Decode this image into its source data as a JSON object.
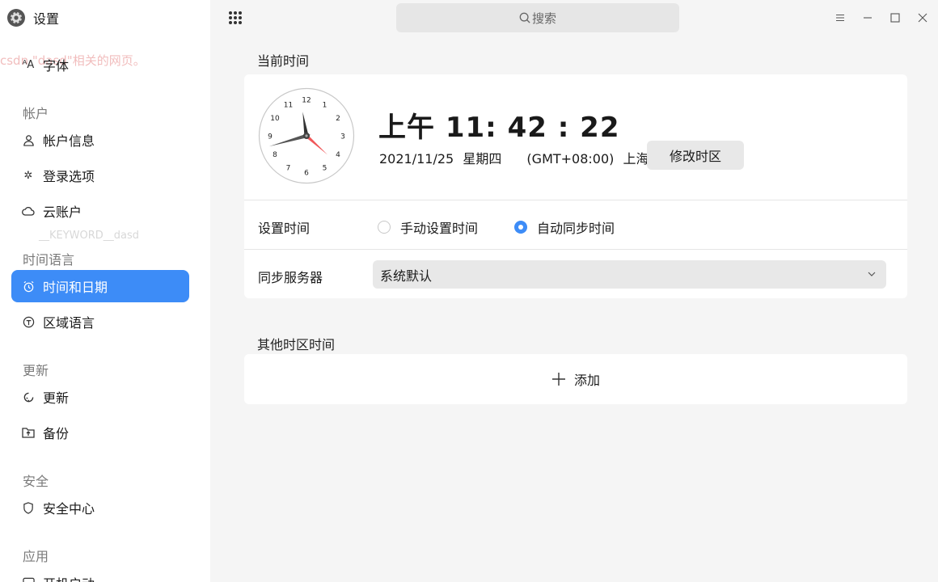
{
  "app": {
    "title": "设置"
  },
  "ghost_text": {
    "line1": "csdn \"dasd\"相关的网页。",
    "line2": "__KEYWORD__dasd"
  },
  "sidebar": {
    "top_item": {
      "label": "字体",
      "icon": "font-icon"
    },
    "groups": [
      {
        "title": "帐户",
        "items": [
          {
            "label": "帐户信息",
            "icon": "user-icon"
          },
          {
            "label": "登录选项",
            "icon": "login-options-icon"
          },
          {
            "label": "云账户",
            "icon": "cloud-icon"
          }
        ]
      },
      {
        "title": "时间语言",
        "items": [
          {
            "label": "时间和日期",
            "icon": "clock-icon",
            "active": true
          },
          {
            "label": "区域语言",
            "icon": "region-language-icon"
          }
        ]
      },
      {
        "title": "更新",
        "items": [
          {
            "label": "更新",
            "icon": "refresh-icon"
          },
          {
            "label": "备份",
            "icon": "backup-icon"
          }
        ]
      },
      {
        "title": "安全",
        "items": [
          {
            "label": "安全中心",
            "icon": "shield-icon"
          }
        ]
      },
      {
        "title": "应用",
        "items": [
          {
            "label": "开机启动",
            "icon": "startup-icon"
          }
        ]
      }
    ]
  },
  "titlebar": {
    "search_placeholder": "搜索"
  },
  "current_time": {
    "section_title": "当前时间",
    "time_display": "上午 11: 42 : 22",
    "date": "2021/11/25",
    "weekday": "星期四",
    "timezone": "(GMT+08:00)",
    "city": "上海",
    "change_tz_button": "修改时区",
    "clock": {
      "hour": 11,
      "minute": 42,
      "second": 22,
      "numbers": [
        "12",
        "1",
        "2",
        "3",
        "4",
        "5",
        "6",
        "7",
        "8",
        "9",
        "10",
        "11"
      ]
    }
  },
  "set_time": {
    "label": "设置时间",
    "manual_label": "手动设置时间",
    "auto_label": "自动同步时间",
    "selected": "auto"
  },
  "sync_server": {
    "label": "同步服务器",
    "value": "系统默认"
  },
  "other_tz": {
    "section_title": "其他时区时间",
    "add_label": "添加"
  },
  "colors": {
    "accent": "#3d8cf7",
    "second_hand": "#f0585a",
    "background": "#f5f5f5"
  }
}
